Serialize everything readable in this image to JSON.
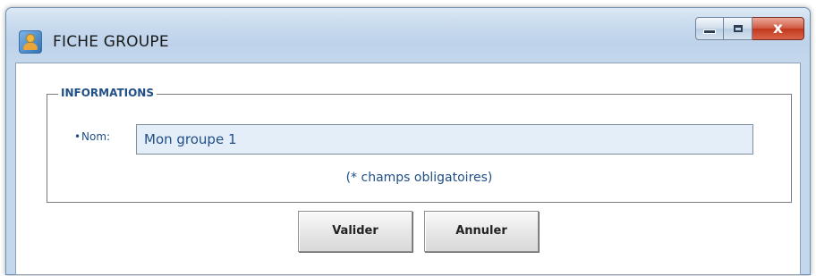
{
  "window": {
    "title": "FICHE GROUPE",
    "controls": {
      "minimize": "minimize-icon",
      "maximize": "maximize-icon",
      "close_glyph": "x"
    }
  },
  "form": {
    "section_title": "INFORMATIONS",
    "required_marker": "•",
    "name_label": "Nom:",
    "name_value": "Mon groupe 1",
    "required_note": "(* champs obligatoires)"
  },
  "buttons": {
    "validate": "Valider",
    "cancel": "Annuler"
  },
  "colors": {
    "accent_text": "#1f4f86",
    "close_button": "#c2371c",
    "input_background": "#e4eef8"
  }
}
